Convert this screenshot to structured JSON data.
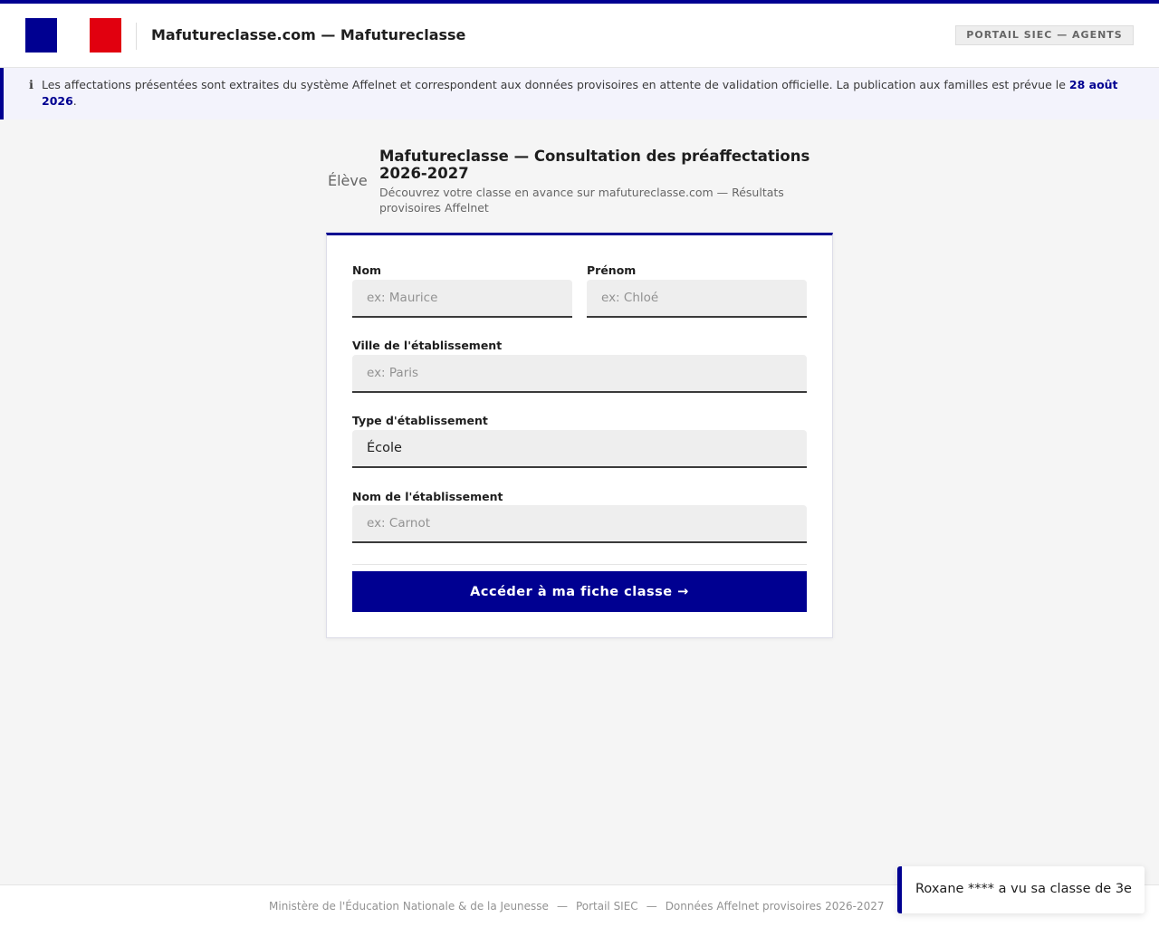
{
  "header": {
    "site_title": "Mafutureclasse.com — Mafutureclasse",
    "portal_badge": "PORTAIL SIEC — AGENTS",
    "flag_colors": [
      "#000091",
      "#ffffff",
      "#e1000f"
    ]
  },
  "notice": {
    "icon": "info-icon",
    "icon_glyph": "ℹ",
    "text": "Les affectations présentées sont extraites du système Affelnet et correspondent aux données provisoires en attente de validation officielle. La publication aux familles est prévue le ",
    "date": "28 août 2026",
    "suffix": "."
  },
  "form": {
    "section_label": "Élève",
    "title": "Mafutureclasse — Consultation des préaffectations 2026-2027",
    "subtitle": "Découvrez votre classe en avance sur mafutureclasse.com — Résultats provisoires Affelnet",
    "fields": {
      "nom": {
        "label": "Nom",
        "placeholder": "ex: Maurice"
      },
      "prenom": {
        "label": "Prénom",
        "placeholder": "ex: Chloé"
      },
      "ville": {
        "label": "Ville de l'établissement",
        "placeholder": "ex: Paris"
      },
      "type": {
        "label": "Type d'établissement",
        "value": "École"
      },
      "etablissement": {
        "label": "Nom de l'établissement",
        "placeholder": "ex: Carnot"
      }
    },
    "submit_label": "Accéder à ma fiche classe →"
  },
  "footer": {
    "items": [
      "Ministère de l'Éducation Nationale & de la Jeunesse",
      "Portail SIEC",
      "Données Affelnet provisoires 2026-2027"
    ],
    "separator": "—"
  },
  "toast": {
    "text": "Roxane **** a vu sa classe de 3e"
  },
  "colors": {
    "accent": "#000091",
    "flag_red": "#e1000f",
    "notice_bg": "#f3f3fc"
  }
}
